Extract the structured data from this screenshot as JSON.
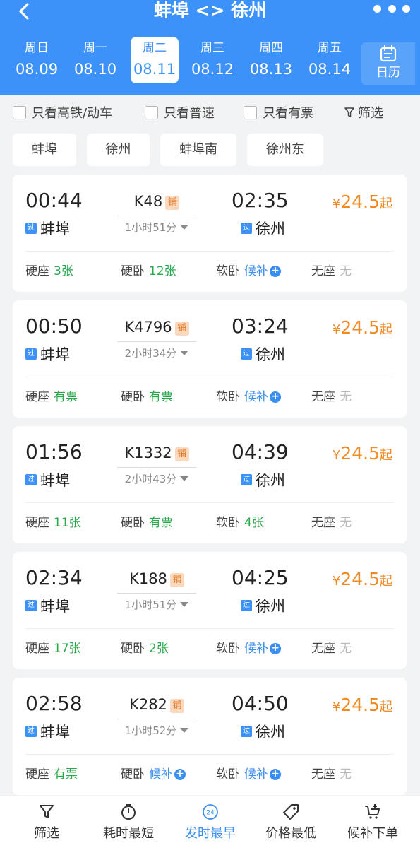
{
  "header": {
    "title": "蚌埠 <> 徐州"
  },
  "dates": [
    {
      "weekday": "周日",
      "date": "08.09"
    },
    {
      "weekday": "周一",
      "date": "08.10"
    },
    {
      "weekday": "周二",
      "date": "08.11",
      "active": true
    },
    {
      "weekday": "周三",
      "date": "08.12"
    },
    {
      "weekday": "周四",
      "date": "08.13"
    },
    {
      "weekday": "周五",
      "date": "08.14"
    }
  ],
  "calendar_label": "日历",
  "filters": {
    "high_speed": "只看高铁/动车",
    "normal": "只看普速",
    "available": "只看有票",
    "filter": "筛选"
  },
  "stations": [
    "蚌埠",
    "徐州",
    "蚌埠南",
    "徐州东"
  ],
  "trains": [
    {
      "dep_time": "00:44",
      "arr_time": "02:35",
      "train_no": "K48",
      "badge": "铺",
      "duration": "1小时51分",
      "pass_badge": "过",
      "dep_station": "蚌埠",
      "arr_station": "徐州",
      "price_symbol": "¥",
      "price": "24.5",
      "price_suffix": "起",
      "seats": [
        {
          "type": "硬座",
          "value": "3张",
          "status": "green"
        },
        {
          "type": "硬卧",
          "value": "12张",
          "status": "green"
        },
        {
          "type": "软卧",
          "value": "候补",
          "status": "blue"
        },
        {
          "type": "无座",
          "value": "无",
          "status": "gray"
        }
      ]
    },
    {
      "dep_time": "00:50",
      "arr_time": "03:24",
      "train_no": "K4796",
      "badge": "铺",
      "duration": "2小时34分",
      "pass_badge": "过",
      "dep_station": "蚌埠",
      "arr_station": "徐州",
      "price_symbol": "¥",
      "price": "24.5",
      "price_suffix": "起",
      "seats": [
        {
          "type": "硬座",
          "value": "有票",
          "status": "green"
        },
        {
          "type": "硬卧",
          "value": "有票",
          "status": "green"
        },
        {
          "type": "软卧",
          "value": "候补",
          "status": "blue"
        },
        {
          "type": "无座",
          "value": "无",
          "status": "gray"
        }
      ]
    },
    {
      "dep_time": "01:56",
      "arr_time": "04:39",
      "train_no": "K1332",
      "badge": "铺",
      "duration": "2小时43分",
      "pass_badge": "过",
      "dep_station": "蚌埠",
      "arr_station": "徐州",
      "price_symbol": "¥",
      "price": "24.5",
      "price_suffix": "起",
      "seats": [
        {
          "type": "硬座",
          "value": "11张",
          "status": "green"
        },
        {
          "type": "硬卧",
          "value": "有票",
          "status": "green"
        },
        {
          "type": "软卧",
          "value": "4张",
          "status": "green"
        },
        {
          "type": "无座",
          "value": "无",
          "status": "gray"
        }
      ]
    },
    {
      "dep_time": "02:34",
      "arr_time": "04:25",
      "train_no": "K188",
      "badge": "铺",
      "duration": "1小时51分",
      "pass_badge": "过",
      "dep_station": "蚌埠",
      "arr_station": "徐州",
      "price_symbol": "¥",
      "price": "24.5",
      "price_suffix": "起",
      "seats": [
        {
          "type": "硬座",
          "value": "17张",
          "status": "green"
        },
        {
          "type": "硬卧",
          "value": "2张",
          "status": "green"
        },
        {
          "type": "软卧",
          "value": "候补",
          "status": "blue"
        },
        {
          "type": "无座",
          "value": "无",
          "status": "gray"
        }
      ]
    },
    {
      "dep_time": "02:58",
      "arr_time": "04:50",
      "train_no": "K282",
      "badge": "铺",
      "duration": "1小时52分",
      "pass_badge": "过",
      "dep_station": "蚌埠",
      "arr_station": "徐州",
      "price_symbol": "¥",
      "price": "24.5",
      "price_suffix": "起",
      "seats": [
        {
          "type": "硬座",
          "value": "有票",
          "status": "green"
        },
        {
          "type": "硬卧",
          "value": "候补",
          "status": "blue"
        },
        {
          "type": "软卧",
          "value": "候补",
          "status": "blue"
        },
        {
          "type": "无座",
          "value": "无",
          "status": "gray"
        }
      ]
    }
  ],
  "tabbar": {
    "filter": "筛选",
    "shortest": "耗时最短",
    "earliest": "发时最早",
    "earliest_icon_text": "24",
    "cheapest": "价格最低",
    "waitlist": "候补下单"
  },
  "colors": {
    "header_blue": "#3c92f8",
    "price_orange": "#f08a24",
    "available_green": "#29a84c",
    "waitlist_blue": "#3c8ef0",
    "none_gray": "#bbbbbb"
  }
}
